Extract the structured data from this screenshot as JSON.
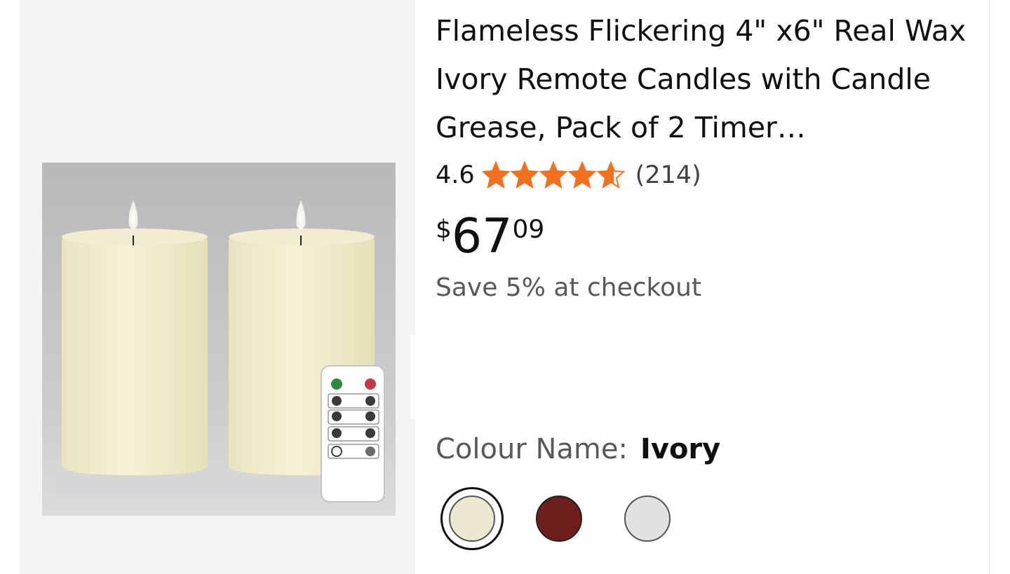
{
  "product": {
    "title": "Flameless Flickering 4\" x6\" Real Wax Ivory Remote Candles with Candle Grease, Pack of 2 Timer…",
    "rating": {
      "value_label": "4.6",
      "value": 4.6,
      "max": 5,
      "count_label": "(214)",
      "star_color": "#f3701f"
    },
    "price": {
      "symbol": "$",
      "whole": "67",
      "fraction": "09"
    },
    "savings_text": "Save 5% at checkout",
    "colour": {
      "label": "Colour Name:",
      "selected": "Ivory",
      "swatches": [
        {
          "name": "ivory-swatch",
          "color": "#ece9d0",
          "selected": true
        },
        {
          "name": "burgundy-swatch",
          "color": "#6d1f1d",
          "selected": false
        },
        {
          "name": "white-swatch",
          "color": "#e2e2e2",
          "selected": false
        }
      ]
    }
  }
}
